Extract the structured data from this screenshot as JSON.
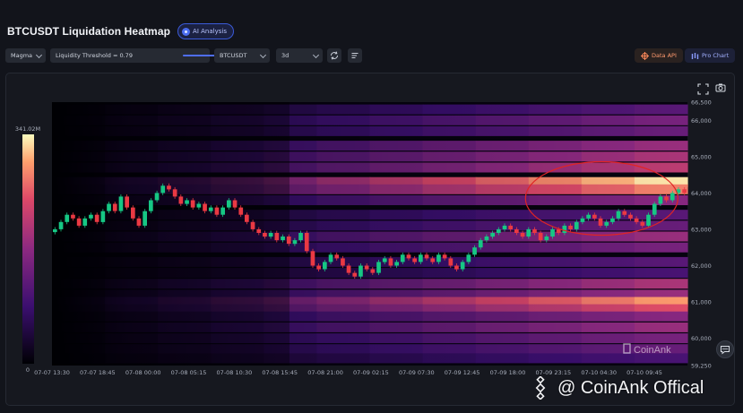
{
  "header": {
    "title": "BTCUSDT Liquidation Heatmap",
    "ai_badge": "AI Analysis"
  },
  "toolbar": {
    "palette": "Magma",
    "threshold_label": "Liquidity Threshold = 0.79",
    "threshold_value": 0.79,
    "symbol": "BTCUSDT",
    "timeframe": "3d",
    "data_api": "Data API",
    "pro_chart": "Pro Chart"
  },
  "colors": {
    "accent": "#4f6ef7",
    "data_api": "#ff8a5b",
    "pro_chart": "#8a9bff",
    "up": "#16c784",
    "down": "#ea3943",
    "highlight": "#e02424"
  },
  "chart_data": {
    "type": "heatmap",
    "title": "",
    "x_ticks": [
      "07-07 13:30",
      "07-07 18:45",
      "07-08 00:00",
      "07-08 05:15",
      "07-08 10:30",
      "07-08 15:45",
      "07-08 21:00",
      "07-09 02:15",
      "07-09 07:30",
      "07-09 12:45",
      "07-09 18:00",
      "07-09 23:15",
      "07-10 04:30",
      "07-10 09:45"
    ],
    "y_ticks": [
      66500,
      66000,
      65000,
      64000,
      63000,
      62000,
      61000,
      60000,
      59250
    ],
    "ylim": [
      59250,
      66500
    ],
    "colorbar": {
      "max_label": "341.02M",
      "min_label": "0",
      "palette": "magma"
    },
    "liquidation_bands": [
      {
        "price": 66300,
        "intensity": 0.35
      },
      {
        "price": 66000,
        "intensity": 0.45
      },
      {
        "price": 65700,
        "intensity": 0.4
      },
      {
        "price": 65300,
        "intensity": 0.55
      },
      {
        "price": 65000,
        "intensity": 0.6
      },
      {
        "price": 64700,
        "intensity": 0.65
      },
      {
        "price": 64300,
        "intensity": 1.0
      },
      {
        "price": 64100,
        "intensity": 0.85
      },
      {
        "price": 63800,
        "intensity": 0.5
      },
      {
        "price": 63400,
        "intensity": 0.35
      },
      {
        "price": 63100,
        "intensity": 0.4
      },
      {
        "price": 62800,
        "intensity": 0.55
      },
      {
        "price": 62500,
        "intensity": 0.45
      },
      {
        "price": 62100,
        "intensity": 0.35
      },
      {
        "price": 61800,
        "intensity": 0.3
      },
      {
        "price": 61500,
        "intensity": 0.6
      },
      {
        "price": 61200,
        "intensity": 0.55
      },
      {
        "price": 61000,
        "intensity": 0.9
      },
      {
        "price": 60800,
        "intensity": 0.75
      },
      {
        "price": 60600,
        "intensity": 0.5
      },
      {
        "price": 60300,
        "intensity": 0.55
      },
      {
        "price": 60000,
        "intensity": 0.45
      },
      {
        "price": 59700,
        "intensity": 0.4
      },
      {
        "price": 59450,
        "intensity": 0.3
      }
    ],
    "price_path": [
      63000,
      63200,
      63400,
      63300,
      63100,
      63300,
      63400,
      63200,
      63500,
      63700,
      63500,
      63900,
      63600,
      63300,
      63100,
      63500,
      63800,
      64000,
      64200,
      64100,
      63900,
      63700,
      63800,
      63600,
      63700,
      63500,
      63600,
      63400,
      63600,
      63800,
      63600,
      63400,
      63200,
      63000,
      62900,
      62800,
      62900,
      62700,
      62800,
      62600,
      62700,
      62900,
      62400,
      62000,
      61900,
      62100,
      62300,
      62200,
      62000,
      61800,
      61700,
      62000,
      61900,
      61800,
      62100,
      62200,
      62000,
      62100,
      62300,
      62200,
      62100,
      62300,
      62200,
      62100,
      62300,
      62200,
      62000,
      61900,
      62100,
      62300,
      62500,
      62700,
      62800,
      62900,
      63000,
      63100,
      63000,
      62900,
      62800,
      63000,
      62900,
      62700,
      62800,
      63000,
      62900,
      63100,
      63000,
      63200,
      63300,
      63400,
      63300,
      63100,
      63200,
      63300,
      63500,
      63400,
      63300,
      63200,
      63100,
      63400,
      63700,
      63900,
      63800,
      64000,
      64100,
      64000
    ],
    "annotation": {
      "shape": "ellipse",
      "price": 63850,
      "x_fraction": 0.865
    }
  },
  "brand": {
    "watermark_chart": "CoinAnk",
    "watermark_footer": "@ CoinAnk Offical"
  }
}
